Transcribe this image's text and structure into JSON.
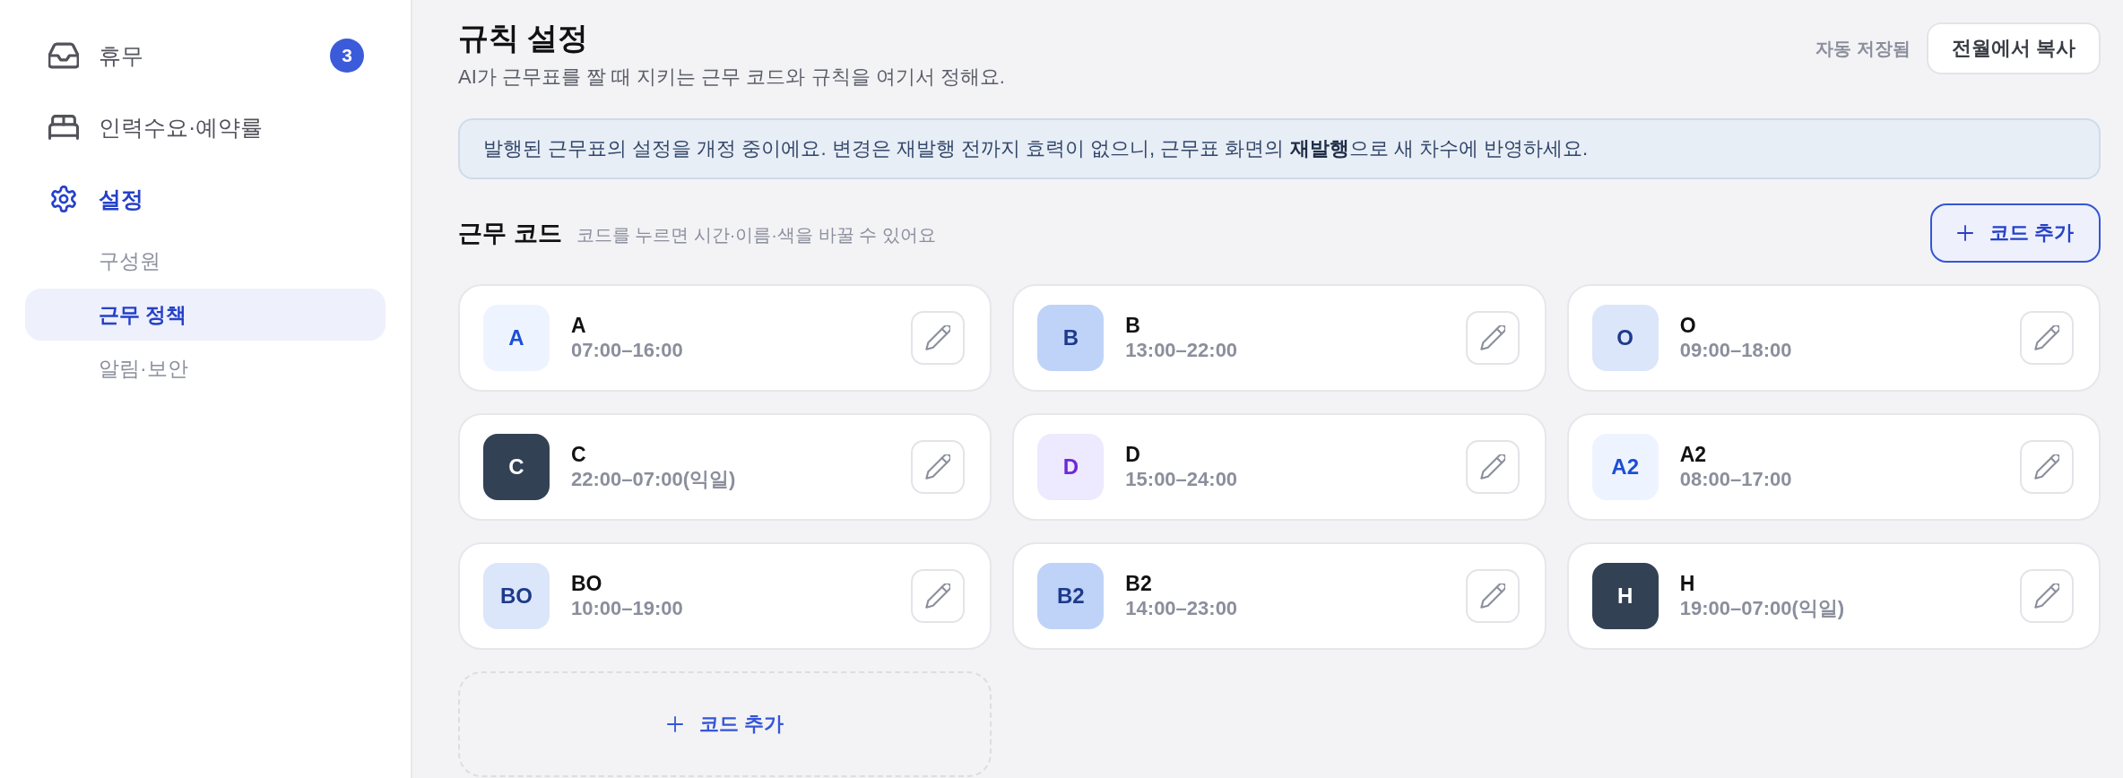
{
  "sidebar": {
    "items": [
      {
        "label": "휴무",
        "badge": "3",
        "selected": false
      },
      {
        "label": "인력수요·예약률",
        "selected": false
      },
      {
        "label": "설정",
        "selected": true,
        "children": [
          {
            "label": "구성원",
            "selected": false
          },
          {
            "label": "근무 정책",
            "selected": true
          },
          {
            "label": "알림·보안",
            "selected": false
          }
        ]
      }
    ]
  },
  "header": {
    "title": "규칙 설정",
    "subtitle": "AI가 근무표를 짤 때 지키는 근무 코드와 규칙을 여기서 정해요.",
    "save_status": "자동 저장됨",
    "copy_button": "전월에서 복사"
  },
  "notice": "발행된 근무표의 설정을 개정 중이에요. 변경은 재발행 전까지 효력이 없으니, 근무표 화면의 **재발행**으로 새 차수에 반영하세요.",
  "codes_section": {
    "title": "근무 코드",
    "hint": "코드를 누르면 시간·이름·색을 바꿀 수 있어요",
    "add_button": "코드 추가",
    "codes": [
      {
        "badge": {
          "label": "A",
          "color": "#1d4ed8",
          "background": {
            "color": "#eef4ff"
          }
        },
        "name": "A",
        "time": "07:00–16:00"
      },
      {
        "badge": {
          "label": "B",
          "color": "#1e3a8a",
          "background": {
            "color": "#bfd3f8"
          }
        },
        "name": "B",
        "time": "13:00–22:00"
      },
      {
        "badge": {
          "label": "O",
          "color": "#1e3a8a",
          "background": {
            "color": "#dce6fa"
          }
        },
        "name": "O",
        "time": "09:00–18:00"
      },
      {
        "badge": {
          "label": "C",
          "color": "#ffffff",
          "background": {
            "color": "#334155"
          }
        },
        "name": "C",
        "time": "22:00–07:00(익일)"
      },
      {
        "badge": {
          "label": "D",
          "color": "#6d28d9",
          "background": {
            "color": "#ede9fe"
          }
        },
        "name": "D",
        "time": "15:00–24:00"
      },
      {
        "badge": {
          "label": "A2",
          "color": "#1d4ed8",
          "background": {
            "color": "#eef4ff"
          }
        },
        "name": "A2",
        "time": "08:00–17:00"
      },
      {
        "badge": {
          "label": "BO",
          "color": "#1e3a8a",
          "background": {
            "color": "#dce6fa"
          }
        },
        "name": "BO",
        "time": "10:00–19:00"
      },
      {
        "badge": {
          "label": "B2",
          "color": "#1e3a8a",
          "background": {
            "color": "#bfd3f8"
          }
        },
        "name": "B2",
        "time": "14:00–23:00"
      },
      {
        "badge": {
          "label": "H",
          "color": "#ffffff",
          "background": {
            "color": "#334155"
          }
        },
        "name": "H",
        "time": "19:00–07:00(익일)"
      }
    ],
    "add_card": "코드 추가"
  }
}
